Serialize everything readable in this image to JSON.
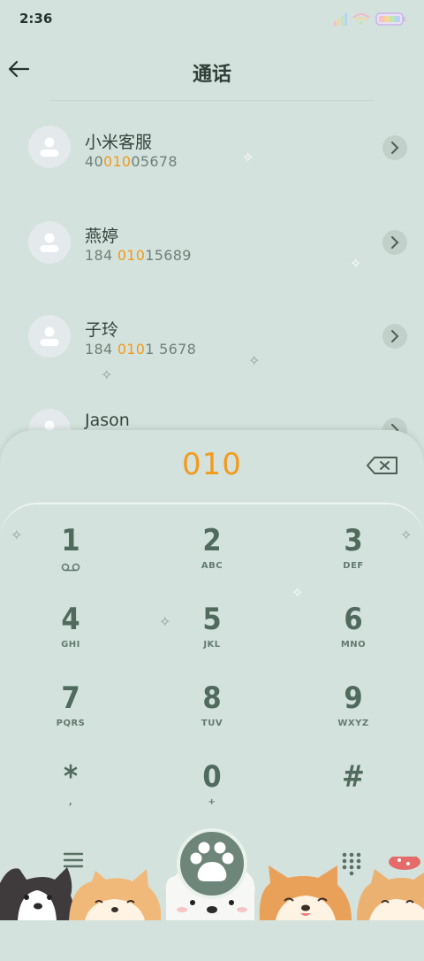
{
  "status_bar": {
    "time": "2:36",
    "icons": [
      "signal-icon",
      "wifi-icon",
      "battery-icon"
    ]
  },
  "header": {
    "title": "通话",
    "back_icon": "back-arrow-icon"
  },
  "contacts": [
    {
      "name": "小米客服",
      "number_pre": "40",
      "number_hl": "010",
      "number_post": "05678"
    },
    {
      "name": "燕婷",
      "number_pre": "184 ",
      "number_hl": "010",
      "number_post": "15689"
    },
    {
      "name": "子玲",
      "number_pre": "184 ",
      "number_hl": "010",
      "number_post": "1 5678"
    },
    {
      "name": "Jason",
      "number_pre": "",
      "number_hl": "",
      "number_post": ""
    }
  ],
  "dialer": {
    "input": "010",
    "keys": [
      {
        "digit": "1",
        "letters": ""
      },
      {
        "digit": "2",
        "letters": "ABC"
      },
      {
        "digit": "3",
        "letters": "DEF"
      },
      {
        "digit": "4",
        "letters": "GHI"
      },
      {
        "digit": "5",
        "letters": "JKL"
      },
      {
        "digit": "6",
        "letters": "MNO"
      },
      {
        "digit": "7",
        "letters": "PQRS"
      },
      {
        "digit": "8",
        "letters": "TUV"
      },
      {
        "digit": "9",
        "letters": "WXYZ"
      },
      {
        "digit": "*",
        "letters": ","
      },
      {
        "digit": "0",
        "letters": "+"
      },
      {
        "digit": "#",
        "letters": ""
      }
    ]
  },
  "colors": {
    "background": "#d3e2dc",
    "highlight": "#f39a1d",
    "key_text": "#506a5e",
    "call_button": "#6e8679"
  }
}
